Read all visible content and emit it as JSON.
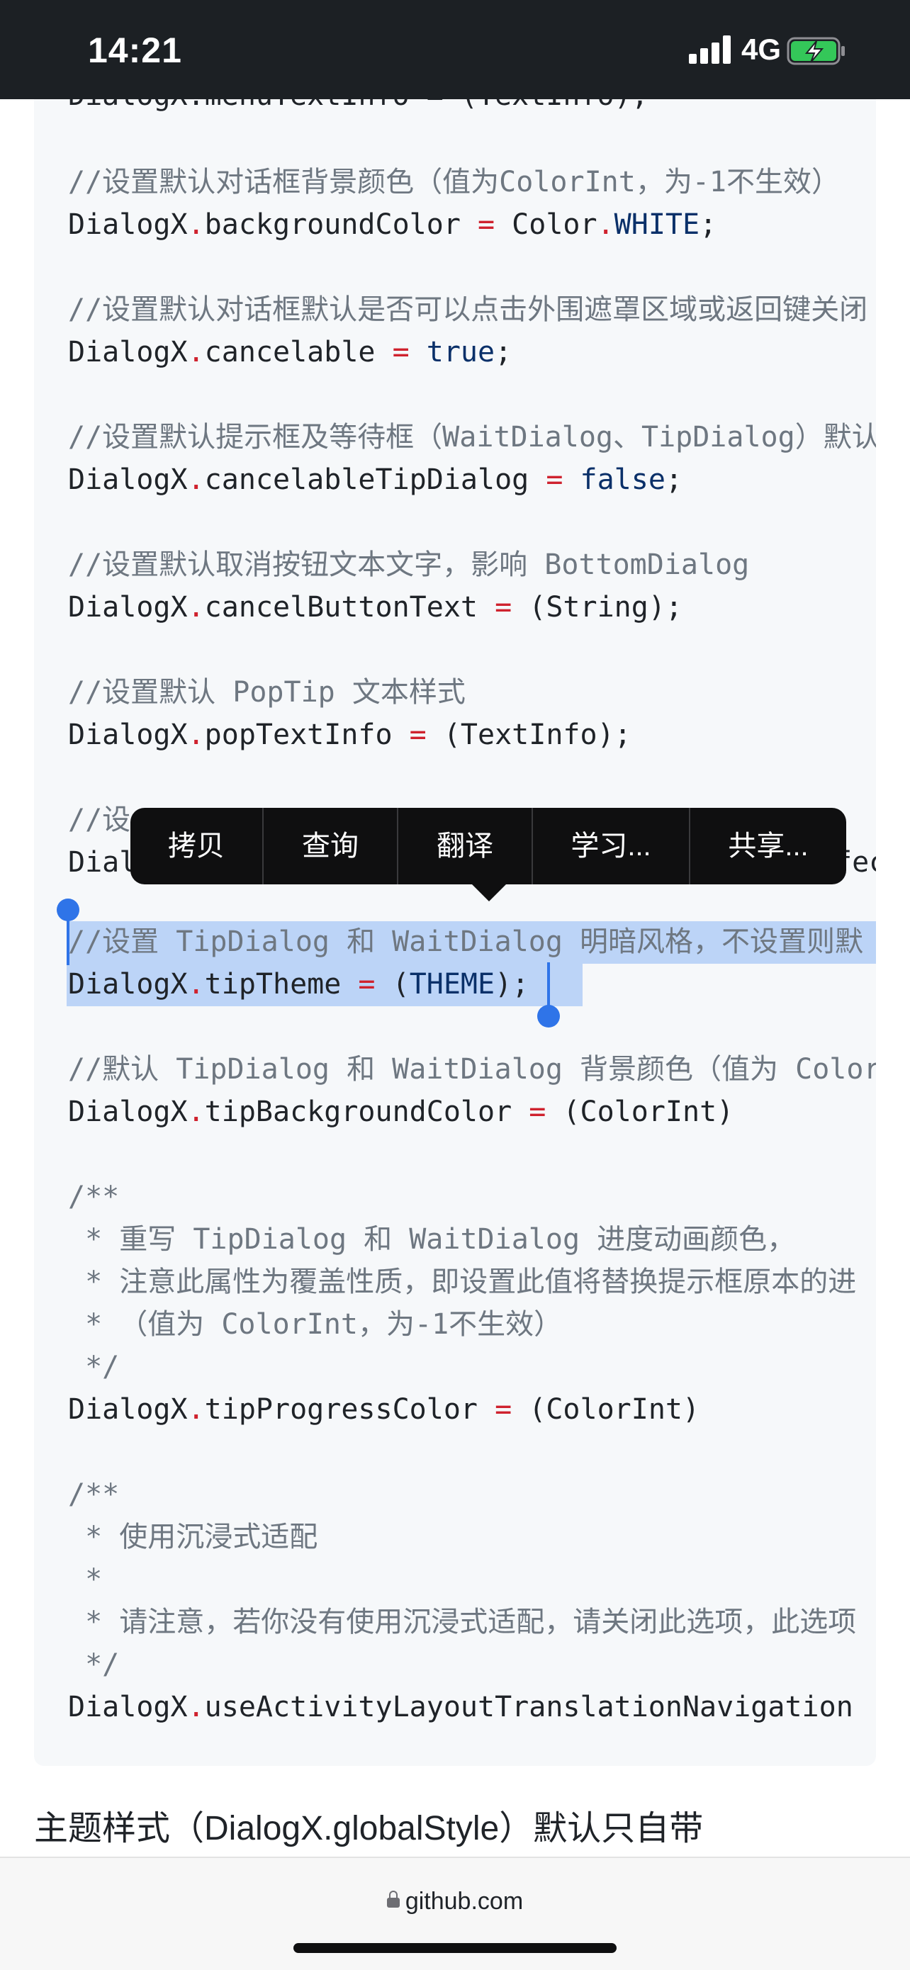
{
  "status": {
    "time": "14:21",
    "network": "4G"
  },
  "code": {
    "partial_top": "DialogX.menuTextInfo = (TextInfo);",
    "l1": "//设置默认对话框背景颜色（值为ColorInt，为-1不生效）",
    "l2a": "DialogX",
    "l2b": ".",
    "l2c": "backgroundColor ",
    "l2d": "=",
    "l2e": " Color",
    "l2f": ".",
    "l2g": "WHITE",
    "l2h": ";",
    "l3": "//设置默认对话框默认是否可以点击外围遮罩区域或返回键关闭",
    "l4a": "DialogX",
    "l4b": ".",
    "l4c": "cancelable ",
    "l4d": "=",
    "l4e": " ",
    "l4f": "true",
    "l4g": ";",
    "l5": "//设置默认提示框及等待框（WaitDialog、TipDialog）默认",
    "l6a": "DialogX",
    "l6b": ".",
    "l6c": "cancelableTipDialog ",
    "l6d": "=",
    "l6e": " ",
    "l6f": "false",
    "l6g": ";",
    "l7": "//设置默认取消按钮文本文字，影响 BottomDialog",
    "l8a": "DialogX",
    "l8b": ".",
    "l8c": "cancelButtonText ",
    "l8d": "=",
    "l8e": " (String);",
    "l9": "//设置默认 PopTip 文本样式",
    "l10a": "DialogX",
    "l10b": ".",
    "l10c": "popTextInfo ",
    "l10d": "=",
    "l10e": " (TextInfo);",
    "l11": "//设",
    "l12a": "Dial",
    "l12b": "fec",
    "l13": "//设置 TipDialog 和 WaitDialog 明暗风格，不设置则默",
    "l14a": "DialogX",
    "l14b": ".",
    "l14c": "tipTheme ",
    "l14d": "=",
    "l14e": " (",
    "l14f": "THEME",
    "l14g": ");",
    "l15": "//默认 TipDialog 和 WaitDialog 背景颜色（值为 ColorInt",
    "l16a": "DialogX",
    "l16b": ".",
    "l16c": "tipBackgroundColor ",
    "l16d": "=",
    "l16e": " (ColorInt)",
    "l17": "/**",
    "l18": " * 重写 TipDialog 和 WaitDialog 进度动画颜色，",
    "l19": " * 注意此属性为覆盖性质，即设置此值将替换提示框原本的进",
    "l20": " * （值为 ColorInt，为-1不生效）",
    "l21": " */",
    "l22a": "DialogX",
    "l22b": ".",
    "l22c": "tipProgressColor ",
    "l22d": "=",
    "l22e": " (ColorInt)",
    "l23": "/**",
    "l24": " * 使用沉浸式适配",
    "l25": " *",
    "l26": " * 请注意，若你没有使用沉浸式适配，请关闭此选项，此选项",
    "l27": " */",
    "l28a": "DialogX",
    "l28b": ".",
    "l28c": "useActivityLayoutTranslationNavigation"
  },
  "menu": {
    "copy": "拷贝",
    "lookup": "查询",
    "translate": "翻译",
    "learn": "学习...",
    "share": "共享..."
  },
  "heading": "主题样式（DialogX.globalStyle）默认只自带",
  "url": "github.com",
  "colors": {
    "selection": "#bcd4f7",
    "handle": "#2f74e8",
    "operator": "#cf222e",
    "keyword": "#0a3069",
    "comment": "#6e7781"
  }
}
